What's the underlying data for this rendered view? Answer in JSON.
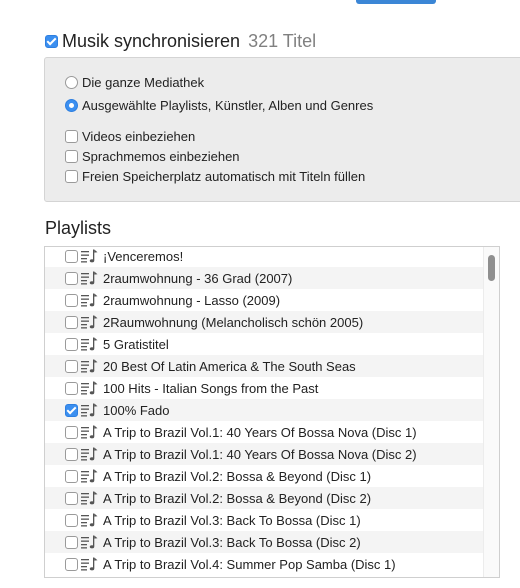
{
  "sync": {
    "label": "Musik synchronisieren",
    "count": "321 Titel",
    "checked": true
  },
  "options": {
    "radio_all": "Die ganze Mediathek",
    "radio_selected": "Ausgewählte Playlists, Künstler, Alben und Genres",
    "include_videos": "Videos einbeziehen",
    "include_voice_memos": "Sprachmemos einbeziehen",
    "fill_free_space": "Freien Speicherplatz automatisch mit Titeln füllen"
  },
  "playlists": {
    "title": "Playlists",
    "items": [
      {
        "label": "¡Venceremos!",
        "checked": false
      },
      {
        "label": "2raumwohnung - 36 Grad (2007)",
        "checked": false
      },
      {
        "label": "2raumwohnung - Lasso (2009)",
        "checked": false
      },
      {
        "label": "2Raumwohnung (Melancholisch schön 2005)",
        "checked": false
      },
      {
        "label": "5 Gratistitel",
        "checked": false
      },
      {
        "label": "20 Best Of Latin America & The South Seas",
        "checked": false
      },
      {
        "label": "100 Hits - Italian Songs from the Past",
        "checked": false
      },
      {
        "label": "100% Fado",
        "checked": true
      },
      {
        "label": "A Trip to Brazil Vol.1: 40 Years Of Bossa Nova (Disc 1)",
        "checked": false
      },
      {
        "label": "A Trip to Brazil Vol.1: 40 Years Of Bossa Nova (Disc 2)",
        "checked": false
      },
      {
        "label": "A Trip to Brazil Vol.2: Bossa & Beyond (Disc 1)",
        "checked": false
      },
      {
        "label": "A Trip to Brazil Vol.2: Bossa & Beyond (Disc 2)",
        "checked": false
      },
      {
        "label": "A Trip to Brazil Vol.3: Back To Bossa (Disc 1)",
        "checked": false
      },
      {
        "label": "A Trip to Brazil Vol.3: Back To Bossa (Disc 2)",
        "checked": false
      },
      {
        "label": "A Trip to Brazil Vol.4: Summer Pop Samba (Disc 1)",
        "checked": false
      }
    ]
  },
  "colors": {
    "accent": "#3b8ff0",
    "panel": "#ececec"
  }
}
